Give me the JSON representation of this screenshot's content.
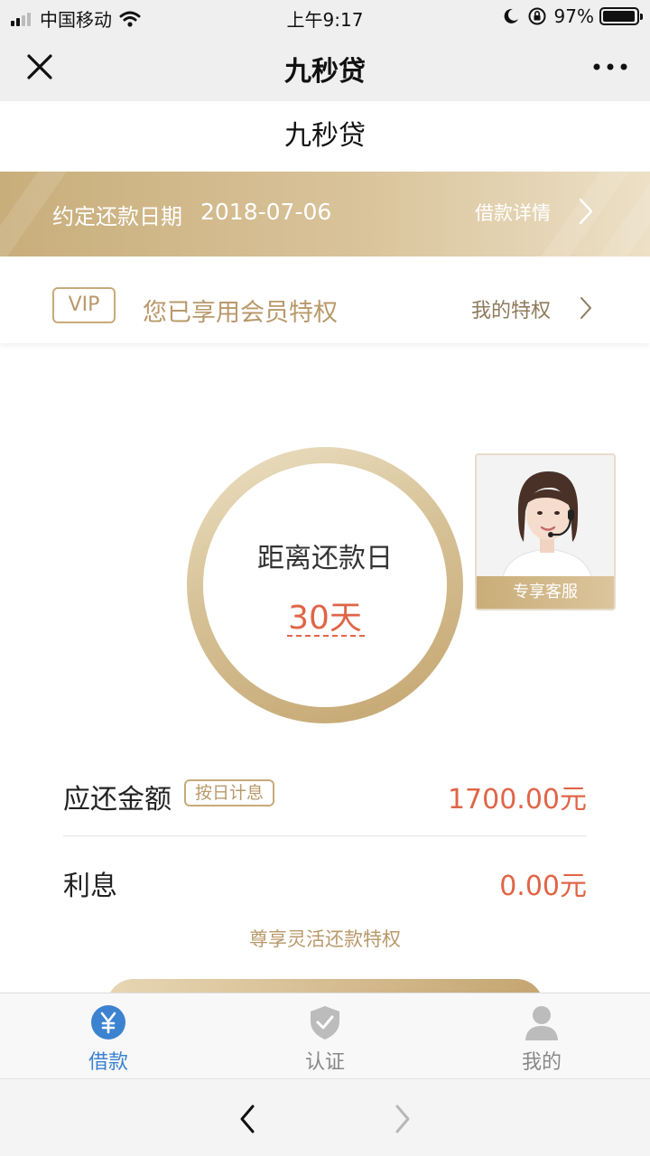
{
  "status_bar": {
    "carrier": "中国移动",
    "time": "上午9:17",
    "battery": "97%",
    "battery_level": 0.97
  },
  "nav": {
    "title": "九秒贷"
  },
  "page": {
    "title": "九秒贷"
  },
  "banner": {
    "label": "约定还款日期",
    "date": "2018-07-06",
    "link": "借款详情"
  },
  "vip": {
    "badge": "VIP",
    "text": "您已享用会员特权",
    "link": "我的特权"
  },
  "countdown": {
    "label": "距离还款日",
    "days": "30天"
  },
  "service": {
    "label": "专享客服"
  },
  "repayment": {
    "amount_label": "应还金额",
    "amount_tag": "按日计息",
    "amount_value": "1700.00元",
    "interest_label": "利息",
    "interest_value": "0.00元",
    "note": "尊享灵活还款特权"
  },
  "tabs": [
    {
      "label": "借款",
      "icon": "yen-icon",
      "active": true
    },
    {
      "label": "认证",
      "icon": "shield-check-icon",
      "active": false
    },
    {
      "label": "我的",
      "icon": "user-icon",
      "active": false
    }
  ],
  "colors": {
    "gold": "#c8ae7b",
    "accent_red": "#e06547",
    "active_blue": "#3b82d1"
  }
}
